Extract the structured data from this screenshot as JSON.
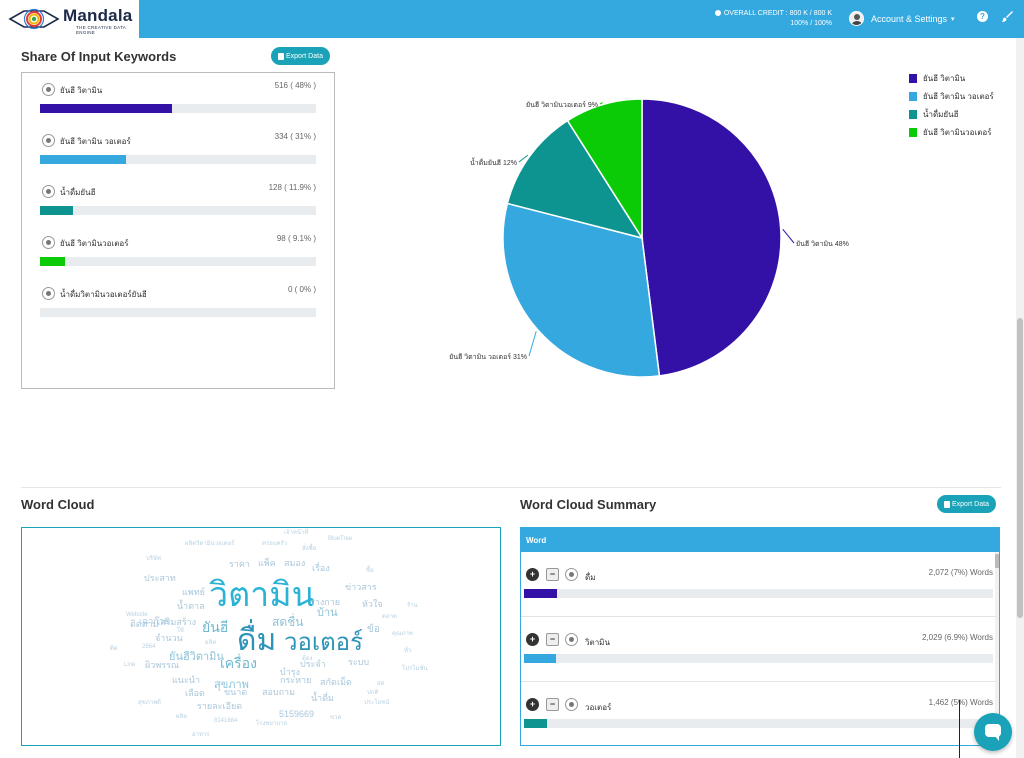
{
  "header": {
    "brand": "Mandala",
    "brand_sub": "THE CREATIVE DATA ENGINE",
    "credit_line1": "OVERALL CREDIT : 800 K / 800 K",
    "credit_line2": "100% / 100%",
    "account_label": "Account & Settings",
    "help_label": "?",
    "colors": {
      "bar": "#33a9e0"
    }
  },
  "share_section": {
    "title": "Share Of Input Keywords",
    "export_label": "Export Data",
    "keywords": [
      {
        "label": "ยันฮี วิตามิน",
        "value": "516 ( 48% )",
        "share": 48,
        "color": "#3411a6"
      },
      {
        "label": "ยันฮี วิตามิน วอเตอร์",
        "value": "334 ( 31% )",
        "share": 31,
        "color": "#35a8e0"
      },
      {
        "label": "น้ำดื่มยันฮี",
        "value": "128 ( 11.9% )",
        "share": 11.9,
        "color": "#0d9490"
      },
      {
        "label": "ยันฮี วิตามินวอเตอร์",
        "value": "98 ( 9.1% )",
        "share": 9.1,
        "color": "#0acb06"
      },
      {
        "label": "น้ำดื่มวิตามินวอเตอร์ยันฮี",
        "value": "0 ( 0% )",
        "share": 0,
        "color": "#0acb06"
      }
    ]
  },
  "chart_data": {
    "type": "pie",
    "labels": [
      "ยันฮี วิตามิน",
      "ยันฮี วิตามิน วอเตอร์",
      "น้ำดื่มยันฮี",
      "ยันฮี วิตามินวอเตอร์"
    ],
    "values": [
      48,
      31,
      12,
      9
    ],
    "slice_labels": [
      "ยันฮี วิตามิน 48%",
      "ยันฮี วิตามิน วอเตอร์ 31%",
      "น้ำดื่มยันฮี 12%",
      "ยันฮี วิตามินวอเตอร์ 9%"
    ],
    "colors": [
      "#3411a6",
      "#35a8e0",
      "#0d9490",
      "#0acb06"
    ],
    "legend_position": "top-right"
  },
  "word_cloud": {
    "title": "Word Cloud",
    "words": [
      {
        "t": "วิตามิน",
        "s": 34,
        "c": "#2bb3d6"
      },
      {
        "t": "ดื่ม",
        "s": 30,
        "c": "#2d93b8"
      },
      {
        "t": "วอเตอร์",
        "s": 24,
        "c": "#2d93b8"
      },
      {
        "t": "เครื่อง",
        "s": 14,
        "c": "#6fb8cf"
      },
      {
        "t": "ยันฮี",
        "s": 14,
        "c": "#6fb8cf"
      },
      {
        "t": "ยันฮีวิตามิน",
        "s": 11,
        "c": "#8ec3d8"
      },
      {
        "t": "สุขภาพ",
        "s": 11,
        "c": "#8ec3d8"
      },
      {
        "t": "สดชื่น",
        "s": 12,
        "c": "#8ec3d8"
      },
      {
        "t": "บ้าน",
        "s": 11,
        "c": "#8ec3d8"
      },
      {
        "t": "ข่าวสาร",
        "s": 9,
        "c": "#a9c7da"
      },
      {
        "t": "ร่างกาย",
        "s": 9,
        "c": "#a9c7da"
      },
      {
        "t": "หัวใจ",
        "s": 9,
        "c": "#a9c7da"
      },
      {
        "t": "ข้อ",
        "s": 10,
        "c": "#a9c7da"
      },
      {
        "t": "ราคา",
        "s": 9,
        "c": "#a9c7da"
      },
      {
        "t": "แพ็ค",
        "s": 9,
        "c": "#a9c7da"
      },
      {
        "t": "สมอง",
        "s": 9,
        "c": "#a9c7da"
      },
      {
        "t": "เรื่อง",
        "s": 9,
        "c": "#a9c7da"
      },
      {
        "t": "ประสาท",
        "s": 9,
        "c": "#a9c7da"
      },
      {
        "t": "แพทย์",
        "s": 9,
        "c": "#a9c7da"
      },
      {
        "t": "เฉาก๊วย",
        "s": 9,
        "c": "#a9c7da"
      },
      {
        "t": "น้ำตาล",
        "s": 9,
        "c": "#a9c7da"
      },
      {
        "t": "ติดตาม",
        "s": 9,
        "c": "#a9c7da"
      },
      {
        "t": "เสริมสร้าง",
        "s": 9,
        "c": "#a9c7da"
      },
      {
        "t": "จำนวน",
        "s": 9,
        "c": "#a9c7da"
      },
      {
        "t": "ผิวพรรณ",
        "s": 9,
        "c": "#a9c7da"
      },
      {
        "t": "บำรุง",
        "s": 9,
        "c": "#a9c7da"
      },
      {
        "t": "ประจำ",
        "s": 9,
        "c": "#a9c7da"
      },
      {
        "t": "ระบบ",
        "s": 9,
        "c": "#a9c7da"
      },
      {
        "t": "แนะนำ",
        "s": 9,
        "c": "#a9c7da"
      },
      {
        "t": "กระหาย",
        "s": 9,
        "c": "#a9c7da"
      },
      {
        "t": "สกัด",
        "s": 9,
        "c": "#a9c7da"
      },
      {
        "t": "เม็ด",
        "s": 9,
        "c": "#a9c7da"
      },
      {
        "t": "เลือด",
        "s": 9,
        "c": "#a9c7da"
      },
      {
        "t": "ขนาด",
        "s": 9,
        "c": "#a9c7da"
      },
      {
        "t": "สอบถาม",
        "s": 9,
        "c": "#a9c7da"
      },
      {
        "t": "น้ำดื่ม",
        "s": 9,
        "c": "#a9c7da"
      },
      {
        "t": "รายละเอียด",
        "s": 9,
        "c": "#a9c7da"
      },
      {
        "t": "5159669",
        "s": 9,
        "c": "#a9c7da"
      },
      {
        "t": "BlueTree",
        "s": 6,
        "c": "#b9d2e2"
      },
      {
        "t": "Website",
        "s": 6,
        "c": "#b9d2e2"
      },
      {
        "t": "Line",
        "s": 6,
        "c": "#b9d2e2"
      },
      {
        "t": "2564",
        "s": 6,
        "c": "#b9d2e2"
      },
      {
        "t": "8141684",
        "s": 6,
        "c": "#b9d2e2"
      },
      {
        "t": "เจ้าหน้าที่",
        "s": 6,
        "c": "#b9d2e2"
      },
      {
        "t": "ครอบครัว",
        "s": 6,
        "c": "#b9d2e2"
      },
      {
        "t": "ผลิตวิตามินวอเตอร์",
        "s": 6,
        "c": "#b9d2e2"
      },
      {
        "t": "บริษัท",
        "s": 6,
        "c": "#b9d2e2"
      },
      {
        "t": "สุขภาพดี",
        "s": 6,
        "c": "#b9d2e2"
      },
      {
        "t": "โรงพยาบาล",
        "s": 6,
        "c": "#b9d2e2"
      },
      {
        "t": "สั่งซื้อ",
        "s": 6,
        "c": "#b9d2e2"
      },
      {
        "t": "คุณภาพ",
        "s": 6,
        "c": "#b9d2e2"
      },
      {
        "t": "ประโยชน์",
        "s": 6,
        "c": "#b9d2e2"
      },
      {
        "t": "ผลิต",
        "s": 6,
        "c": "#b9d2e2"
      },
      {
        "t": "ตลาด",
        "s": 6,
        "c": "#b9d2e2"
      },
      {
        "t": "ทั่ว",
        "s": 6,
        "c": "#b9d2e2"
      },
      {
        "t": "อาหาร",
        "s": 6,
        "c": "#b9d2e2"
      },
      {
        "t": "ติด",
        "s": 6,
        "c": "#b9d2e2"
      },
      {
        "t": "ผลิต",
        "s": 6,
        "c": "#b9d2e2"
      },
      {
        "t": "ใช้",
        "s": 6,
        "c": "#b9d2e2"
      },
      {
        "t": "ขวด",
        "s": 6,
        "c": "#b9d2e2"
      },
      {
        "t": "สด",
        "s": 6,
        "c": "#b9d2e2"
      },
      {
        "t": "โปรโมชั่น",
        "s": 6,
        "c": "#b9d2e2"
      },
      {
        "t": "ซื้อ",
        "s": 6,
        "c": "#b9d2e2"
      },
      {
        "t": "ร้าน",
        "s": 6,
        "c": "#b9d2e2"
      },
      {
        "t": "ต้อง",
        "s": 6,
        "c": "#b9d2e2"
      },
      {
        "t": "ปกติ",
        "s": 6,
        "c": "#b9d2e2"
      }
    ]
  },
  "summary": {
    "title": "Word Cloud Summary",
    "export_label": "Export Data",
    "column_header": "Word",
    "plus": "+",
    "minus": "−",
    "items": [
      {
        "word": "ดื่ม",
        "count": "2,072 (7%) Words",
        "share": 7,
        "color": "#3411a6"
      },
      {
        "word": "วิตามิน",
        "count": "2,029 (6.9%) Words",
        "share": 6.9,
        "color": "#35a8e0"
      },
      {
        "word": "วอเตอร์",
        "count": "1,462 (5%) Words",
        "share": 5,
        "color": "#0d9490"
      }
    ]
  }
}
